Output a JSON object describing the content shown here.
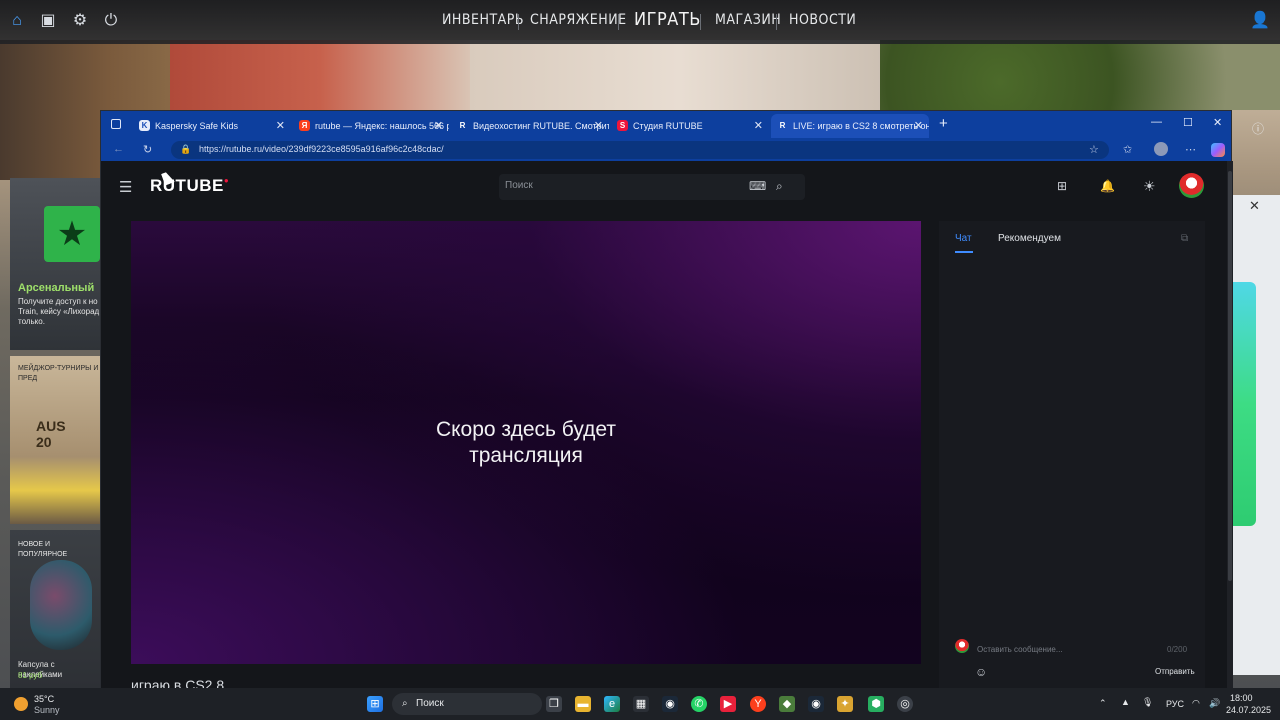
{
  "game": {
    "nav": [
      "ИНВЕНТАРЬ",
      "СНАРЯЖЕНИЕ",
      "ИГРАТЬ",
      "МАГАЗИН",
      "НОВОСТИ"
    ],
    "left_panel": {
      "promo_title": "Арсенальный",
      "promo_text": "Получите доступ к но\nTrain, кейсу «Лихорад\nтолько.",
      "major_label": "МЕЙДЖОР-ТУРНИРЫ И ПРЕД",
      "major_event": "AUS\n20",
      "new_label": "НОВОЕ И ПОПУЛЯРНОЕ",
      "capsule_label": "Капсула с наклейками",
      "capsule_price": "81 руб"
    }
  },
  "browser": {
    "tabs": [
      {
        "label": "Kaspersky Safe Kids",
        "favicon": "K"
      },
      {
        "label": "rutube — Яндекс: нашлось 566 р",
        "favicon": "Я"
      },
      {
        "label": "Видеохостинг RUTUBE. Смотрите",
        "favicon": "R"
      },
      {
        "label": "Студия RUTUBE",
        "favicon": "S"
      },
      {
        "label": "LIVE: играю в CS2 8 смотреть он",
        "favicon": "R"
      }
    ],
    "url": "https://rutube.ru/video/239df9223ce8595a916af96c2c48cdac/"
  },
  "rutube": {
    "logo": "RUTUBE",
    "search_placeholder": "Поиск",
    "player_message": "Скоро здесь будет трансляция",
    "video_title": "играю в CS2 8",
    "side_tabs": [
      "Чат",
      "Рекомендуем"
    ],
    "chat_placeholder": "Оставить сообщение...",
    "chat_counter": "0/200",
    "send_label": "Отправить"
  },
  "taskbar": {
    "temperature": "35°C",
    "weather": "Sunny",
    "search_label": "Поиск",
    "language": "РУС",
    "time": "18:00",
    "date": "24.07.2025"
  },
  "colors": {
    "tabbar": "#0d3f9e",
    "accent": "#3f8cff",
    "rutube_red": "#ed143b"
  }
}
